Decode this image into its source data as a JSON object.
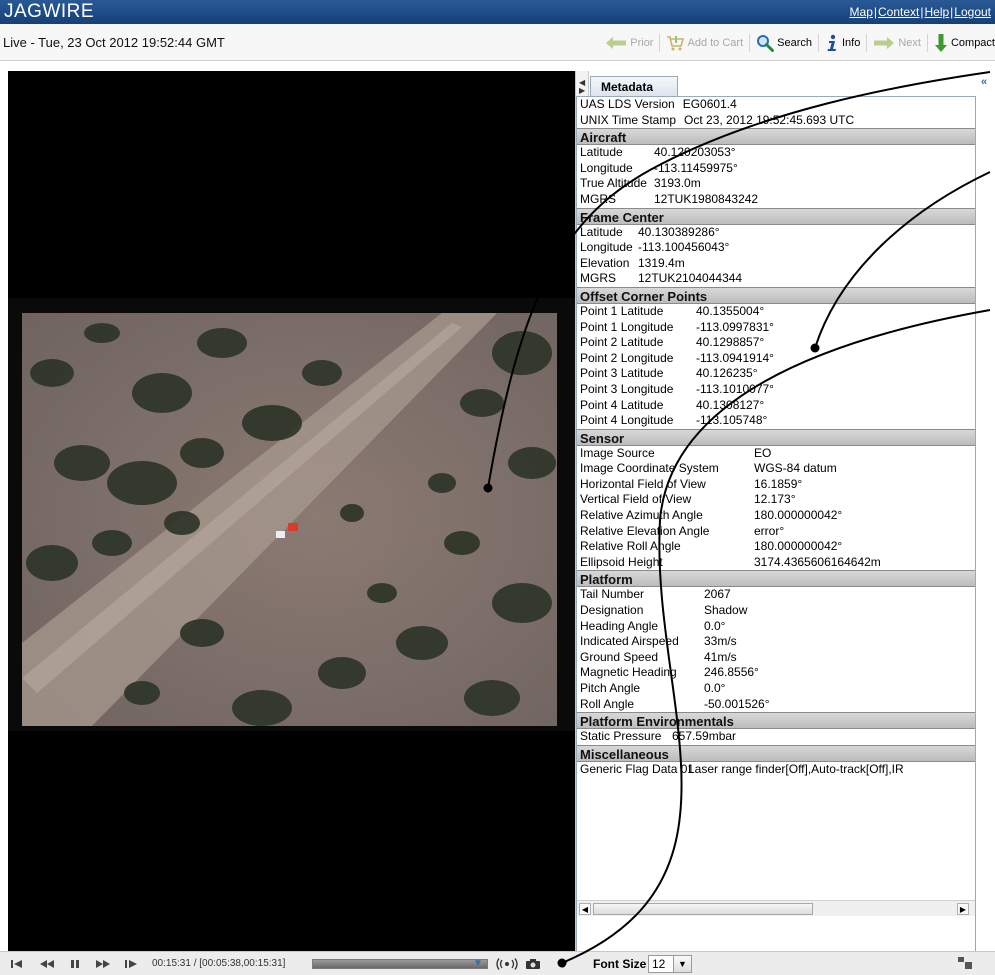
{
  "app": {
    "title": "JAGWIRE",
    "links": [
      "Map",
      "Context",
      "Help",
      "Logout"
    ]
  },
  "toolbar": {
    "live_status": "Live - Tue, 23 Oct 2012 19:52:44 GMT",
    "buttons": [
      {
        "label": "Prior",
        "icon": "arrow-left-icon",
        "enabled": false
      },
      {
        "label": "Add to Cart",
        "icon": "cart-icon",
        "enabled": false
      },
      {
        "label": "Search",
        "icon": "search-icon",
        "enabled": true
      },
      {
        "label": "Info",
        "icon": "info-icon",
        "enabled": true
      },
      {
        "label": "Next",
        "icon": "arrow-right-icon",
        "enabled": false
      },
      {
        "label": "Compact",
        "icon": "arrow-down-icon",
        "enabled": true
      }
    ]
  },
  "metadata": {
    "tab_label": "Metadata",
    "top_rows": [
      {
        "k": "UAS LDS Version",
        "v": "EG0601.4"
      },
      {
        "k": "UNIX Time Stamp",
        "v": "Oct 23, 2012 19:52:45.693 UTC"
      }
    ],
    "sections": [
      {
        "title": "Aircraft",
        "kw": 74,
        "rows": [
          {
            "k": "Latitude",
            "v": "40.120203053°"
          },
          {
            "k": "Longitude",
            "v": "-113.11459975°"
          },
          {
            "k": "True Altitude",
            "v": "3193.0m"
          },
          {
            "k": "MGRS",
            "v": "12TUK1980843242"
          }
        ]
      },
      {
        "title": "Frame Center",
        "kw": 58,
        "rows": [
          {
            "k": "Latitude",
            "v": "40.130389286°"
          },
          {
            "k": "Longitude",
            "v": "-113.100456043°"
          },
          {
            "k": "Elevation",
            "v": "1319.4m"
          },
          {
            "k": "MGRS",
            "v": "12TUK2104044344"
          }
        ]
      },
      {
        "title": "Offset Corner Points",
        "kw": 116,
        "rows": [
          {
            "k": "Point 1 Latitude",
            "v": "40.1355004°"
          },
          {
            "k": "Point 1 Longitude",
            "v": "-113.0997831°"
          },
          {
            "k": "Point 2 Latitude",
            "v": "40.1298857°"
          },
          {
            "k": "Point 2 Longitude",
            "v": "-113.0941914°"
          },
          {
            "k": "Point 3 Latitude",
            "v": "40.126235°"
          },
          {
            "k": "Point 3 Longitude",
            "v": "-113.1010077°"
          },
          {
            "k": "Point 4 Latitude",
            "v": "40.1308127°"
          },
          {
            "k": "Point 4 Longitude",
            "v": "-113.105748°"
          }
        ]
      },
      {
        "title": "Sensor",
        "kw": 174,
        "rows": [
          {
            "k": "Image Source",
            "v": "EO"
          },
          {
            "k": "Image Coordinate System",
            "v": "WGS-84 datum"
          },
          {
            "k": "Horizontal Field of View",
            "v": "16.1859°"
          },
          {
            "k": "Vertical Field of View",
            "v": "12.173°"
          },
          {
            "k": "Relative Azimuth Angle",
            "v": "180.000000042°"
          },
          {
            "k": "Relative Elevation Angle",
            "v": "error°"
          },
          {
            "k": "Relative Roll Angle",
            "v": "180.000000042°"
          },
          {
            "k": "Ellipsoid Height",
            "v": "3174.4365606164642m"
          }
        ]
      },
      {
        "title": "Platform",
        "kw": 124,
        "rows": [
          {
            "k": "Tail Number",
            "v": "2067"
          },
          {
            "k": "Designation",
            "v": "Shadow"
          },
          {
            "k": "Heading Angle",
            "v": "0.0°"
          },
          {
            "k": "Indicated Airspeed",
            "v": "33m/s"
          },
          {
            "k": "Ground Speed",
            "v": "41m/s"
          },
          {
            "k": "Magnetic Heading",
            "v": "246.8556°"
          },
          {
            "k": "Pitch Angle",
            "v": "0.0°"
          },
          {
            "k": "Roll Angle",
            "v": "-50.001526°"
          }
        ]
      },
      {
        "title": "Platform Environmentals",
        "kw": 92,
        "rows": [
          {
            "k": "Static Pressure",
            "v": "657.59mbar"
          }
        ]
      },
      {
        "title": "Miscellaneous",
        "kw": 108,
        "rows": [
          {
            "k": "Generic Flag Data 01",
            "v": "Laser range finder[Off],Auto-track[Off],IR"
          }
        ]
      }
    ]
  },
  "player": {
    "timecode": "00:15:31 / [00:05:38,00:15:31]",
    "progress_fraction": 1.0,
    "controls": [
      "skip-start-icon",
      "rewind-icon",
      "pause-icon",
      "fast-forward-icon",
      "step-forward-icon"
    ]
  },
  "font_size": {
    "label": "Font Size",
    "value": "12"
  }
}
